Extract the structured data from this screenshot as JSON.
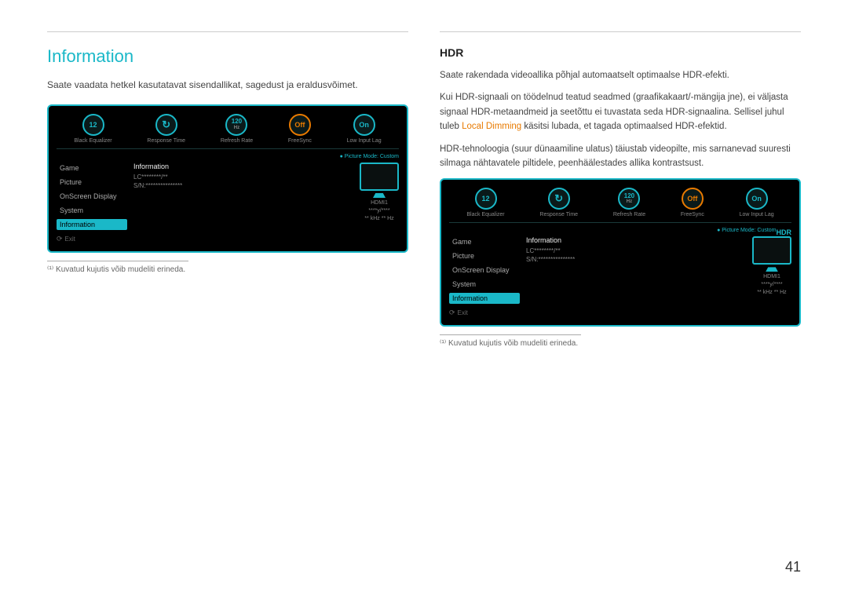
{
  "left_section": {
    "title": "Information",
    "description": "Saate vaadata hetkel kasutatavat sisendallikat, sagedust ja eraldusvõimet.",
    "osd": {
      "dials": [
        {
          "value": "12",
          "label": "Black Equalizer",
          "type": "cyan"
        },
        {
          "value": "↻",
          "label": "Response Time",
          "type": "cyan"
        },
        {
          "value": "120",
          "sublabel": "Hz",
          "label": "Refresh Rate",
          "type": "cyan"
        },
        {
          "value": "Off",
          "label": "FreeSync",
          "type": "orange"
        },
        {
          "value": "On",
          "label": "Low Input Lag",
          "type": "cyan"
        }
      ],
      "picture_mode_label": "● Picture Mode:",
      "picture_mode_value": "Custom",
      "menu_items": [
        {
          "label": "Game",
          "active": false
        },
        {
          "label": "Picture",
          "active": false
        },
        {
          "label": "OnScreen Display",
          "active": false
        },
        {
          "label": "System",
          "active": false
        },
        {
          "label": "Information",
          "active": true
        }
      ],
      "info_title": "Information",
      "info_lines": [
        "LC********/**",
        "S/N:***************"
      ],
      "monitor_label": "HDMI1",
      "monitor_lines": [
        "****y/****",
        "** kHz ** Hz"
      ],
      "exit_label": "Exit"
    },
    "footnote_line": true,
    "footnote": "⁽¹⁾ Kuvatud kujutis võib mudeliti erineda."
  },
  "right_section": {
    "subtitle": "HDR",
    "paragraphs": [
      "Saate rakendada videoallika põhjal automaatselt optimaalse HDR-efekti.",
      "Kui HDR-signaali on töödelnud teatud seadmed (graafikakaart/-mängija jne), ei väljasta signaal HDR-metaandmeid ja seetõttu ei tuvastata seda HDR-signaalina. Sellisel juhul tuleb Local Dimming käsitsi lubada, et tagada optimaalsed HDR-efektid.",
      "HDR-tehnoloogia (suur dünaamiline ulatus) täiustab videopilte, mis sarnanevad suuresti silmaga nähtavatele piltidele, peenhäälestades allika kontrastsust."
    ],
    "highlight_text": "Local Dimming",
    "osd": {
      "dials": [
        {
          "value": "12",
          "label": "Black Equalizer",
          "type": "cyan"
        },
        {
          "value": "↻",
          "label": "Response Time",
          "type": "cyan"
        },
        {
          "value": "120",
          "sublabel": "Hz",
          "label": "Refresh Rate",
          "type": "cyan"
        },
        {
          "value": "Off",
          "label": "FreeSync",
          "type": "orange"
        },
        {
          "value": "On",
          "label": "Low Input Lag",
          "type": "cyan"
        }
      ],
      "picture_mode_label": "● Picture Mode:",
      "picture_mode_value": "Custom",
      "hdr_badge": "HDR",
      "menu_items": [
        {
          "label": "Game",
          "active": false
        },
        {
          "label": "Picture",
          "active": false
        },
        {
          "label": "OnScreen Display",
          "active": false
        },
        {
          "label": "System",
          "active": false
        },
        {
          "label": "Information",
          "active": true
        }
      ],
      "info_title": "Information",
      "info_lines": [
        "LC********/**",
        "S/N:***************"
      ],
      "monitor_label": "HDMI1",
      "monitor_lines": [
        "****y/****",
        "** kHz ** Hz"
      ],
      "exit_label": "Exit"
    },
    "footnote_line": true,
    "footnote": "⁽¹⁾ Kuvatud kujutis võib mudeliti erineda."
  },
  "page_number": "41"
}
